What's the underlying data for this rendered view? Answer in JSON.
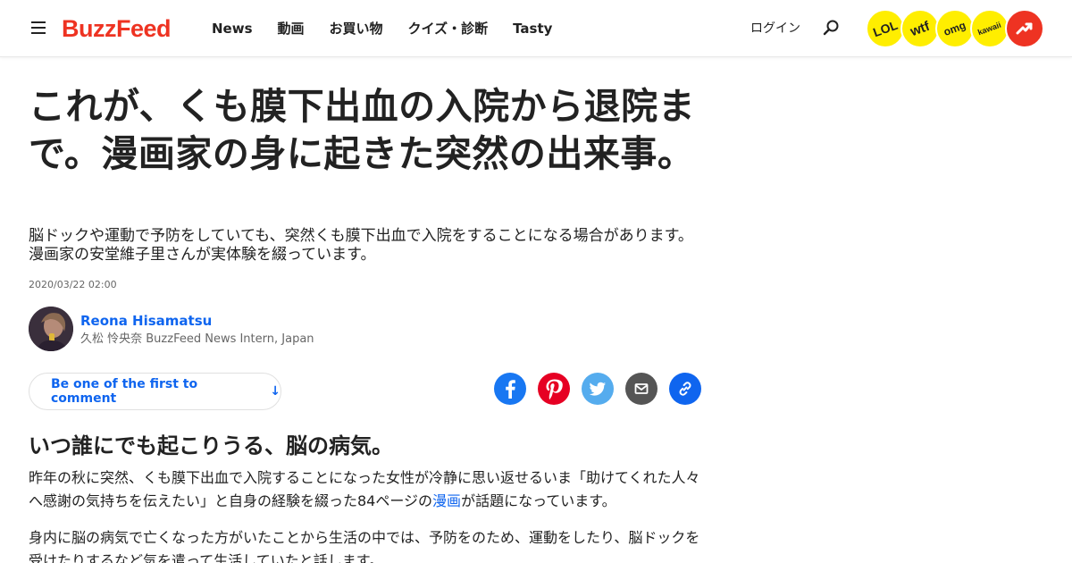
{
  "header": {
    "logo": "BuzzFeed",
    "nav": [
      "News",
      "動画",
      "お買い物",
      "クイズ・診断",
      "Tasty"
    ],
    "login": "ログイン",
    "badges": [
      "LOL",
      "wtf",
      "omg",
      "kawaii"
    ],
    "brand_color": "#ee3322",
    "badge_color": "#ffee00"
  },
  "article": {
    "title": "これが、くも膜下出血の入院から退院まで。漫画家の身に起きた突然の出来事。",
    "dek": "脳ドックや運動で予防をしていても、突然くも膜下出血で入院をすることになる場合があります。漫画家の安堂維子里さんが実体験を綴っています。",
    "timestamp": "2020/03/22 02:00",
    "author": {
      "name": "Reona Hisamatsu",
      "role": "久松 怜央奈 BuzzFeed News Intern, Japan"
    },
    "comment_button": "Be one of the first to comment",
    "comment_arrow": "↓",
    "share_icons": [
      "facebook-icon",
      "pinterest-icon",
      "twitter-icon",
      "mail-icon",
      "link-icon"
    ],
    "section_heading": "いつ誰にでも起こりうる、脳の病気。",
    "paragraph1_before": "昨年の秋に突然、くも膜下出血で入院することになった女性が冷静に思い返せるいま「助けてくれた人々へ感謝の気持ちを伝えたい」と自身の経験を綴った84ページの",
    "paragraph1_link": "漫画",
    "paragraph1_after": "が話題になっています。",
    "paragraph2": "身内に脳の病気で亡くなった方がいたことから生活の中では、予防をのため、運動をしたり、脳ドックを受けたりするなど気を遣って生活していたと話します。",
    "link_color": "#0f65ef"
  }
}
